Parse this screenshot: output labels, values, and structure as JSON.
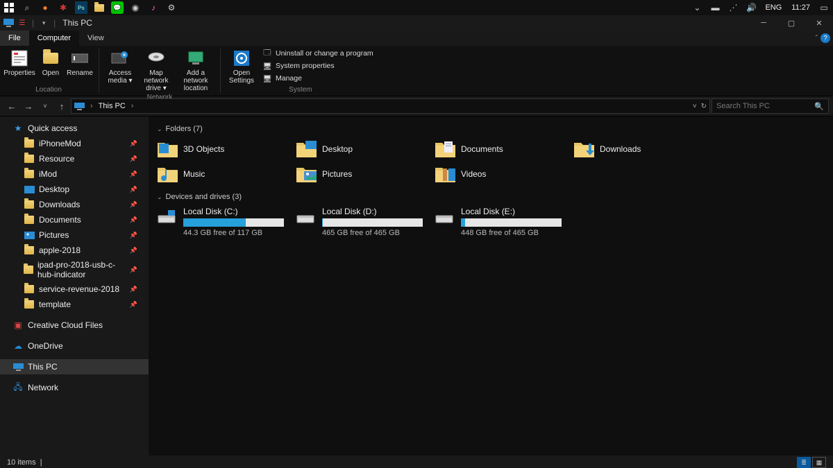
{
  "taskbar": {
    "lang": "ENG",
    "time": "11:27"
  },
  "titlebar": {
    "title": "This PC"
  },
  "tabs": {
    "file": "File",
    "computer": "Computer",
    "view": "View"
  },
  "ribbon": {
    "loc": {
      "properties": "Properties",
      "open": "Open",
      "rename": "Rename",
      "group": "Location"
    },
    "net": {
      "access": "Access media",
      "map": "Map network drive",
      "add": "Add a network location",
      "group": "Network"
    },
    "sys": {
      "open": "Open Settings",
      "p1": "Uninstall or change a program",
      "p2": "System properties",
      "p3": "Manage",
      "group": "System"
    }
  },
  "nav": {
    "crumb": "This PC",
    "search_ph": "Search This PC"
  },
  "sidebar": {
    "quick": "Quick access",
    "pins": [
      "iPhoneMod",
      "Resource",
      "iMod",
      "Desktop",
      "Downloads",
      "Documents",
      "Pictures",
      "apple-2018",
      "ipad-pro-2018-usb-c-hub-indicator",
      "service-revenue-2018",
      "template"
    ],
    "ccf": "Creative Cloud Files",
    "onedrive": "OneDrive",
    "thispc": "This PC",
    "network": "Network"
  },
  "sections": {
    "folders": "Folders (7)",
    "drives": "Devices and drives (3)"
  },
  "folders": [
    "3D Objects",
    "Desktop",
    "Documents",
    "Downloads",
    "Music",
    "Pictures",
    "Videos"
  ],
  "drives": [
    {
      "name": "Local Disk (C:)",
      "free": "44.3 GB free of 117 GB",
      "pct": 62
    },
    {
      "name": "Local Disk (D:)",
      "free": "465 GB free of 465 GB",
      "pct": 1
    },
    {
      "name": "Local Disk (E:)",
      "free": "448 GB free of 465 GB",
      "pct": 4
    }
  ],
  "status": {
    "items": "10 items"
  }
}
